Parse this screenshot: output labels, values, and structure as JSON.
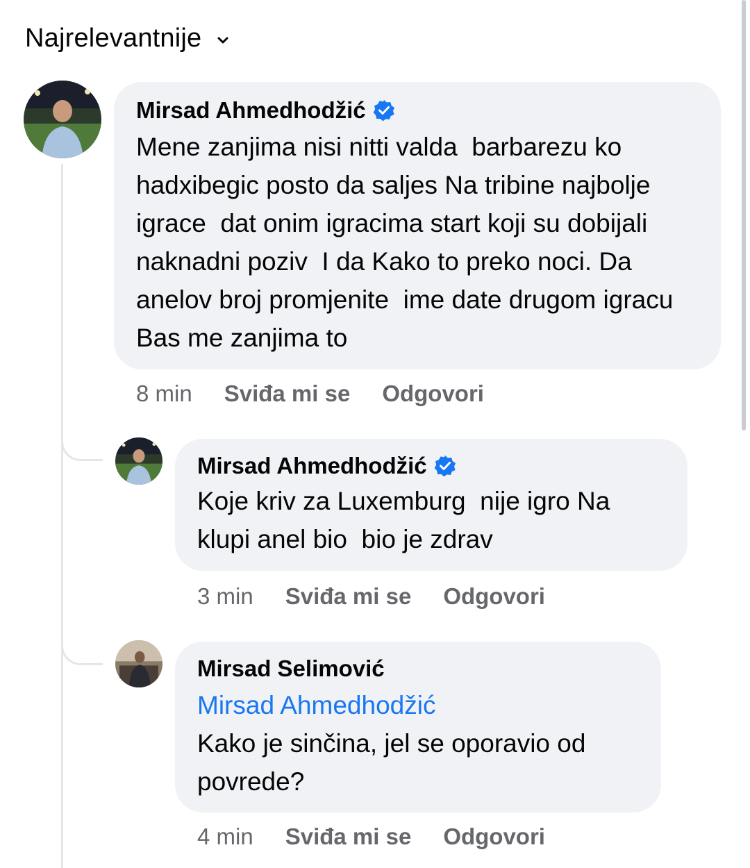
{
  "sort": {
    "label": "Najrelevantnije",
    "icon": "chevron-down-icon"
  },
  "colors": {
    "bubble": "#f0f2f5",
    "text": "#050505",
    "secondary_text": "#65676b",
    "link": "#1877f2",
    "verified_badge": "#1877f2",
    "thread_line": "#e4e6eb"
  },
  "comments": [
    {
      "author": "Mirsad Ahmedhodžić",
      "verified": true,
      "text": "Mene zanjima nisi nitti valda  barbarezu ko hadxibegic posto da saljes Na tribine najbolje igrace  dat onim igracima start koji su dobijali naknadni poziv  I da Kako to preko noci. Da anelov broj promjenite  ime date drugom igracu  Bas me zanjima to",
      "time": "8 min",
      "like": "Sviđa mi se",
      "reply": "Odgovori"
    },
    {
      "author": "Mirsad Ahmedhodžić",
      "verified": true,
      "text": "Koje kriv za Luxemburg  nije igro Na klupi anel bio  bio je zdrav",
      "time": "3 min",
      "like": "Sviđa mi se",
      "reply": "Odgovori"
    },
    {
      "author": "Mirsad Selimović",
      "verified": false,
      "mention": "Mirsad Ahmedhodžić",
      "text": "Kako je sinčina, jel se oporavio od povrede?",
      "time": "4 min",
      "like": "Sviđa mi se",
      "reply": "Odgovori"
    }
  ]
}
